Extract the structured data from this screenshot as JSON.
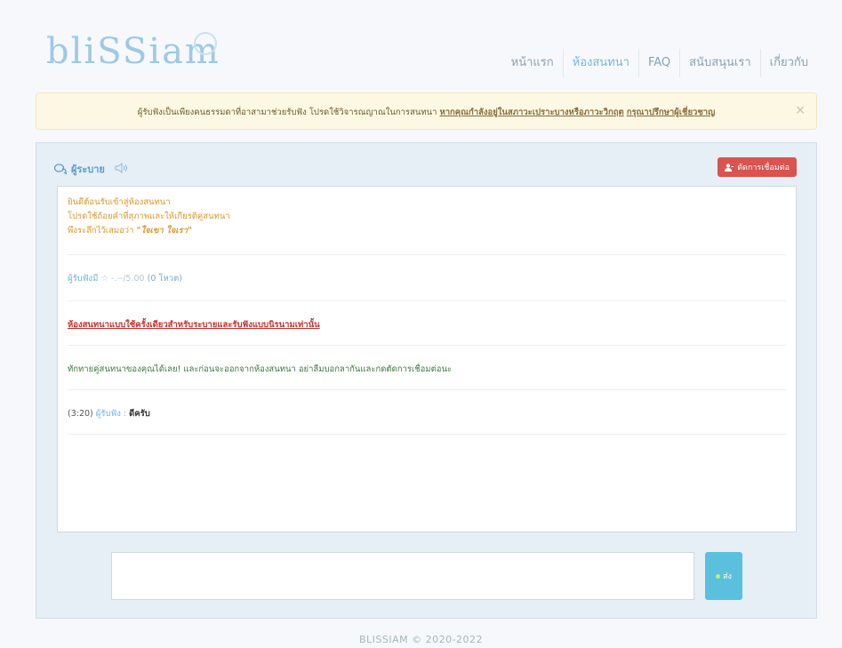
{
  "logo": {
    "text": "bliSSiam"
  },
  "nav": {
    "items": [
      {
        "label": "หน้าแรก",
        "active": false
      },
      {
        "label": "ห้องสนทนา",
        "active": true
      },
      {
        "label": "FAQ",
        "active": false
      },
      {
        "label": "สนับสนุนเรา",
        "active": false
      },
      {
        "label": "เกี่ยวกับ",
        "active": false
      }
    ]
  },
  "alert": {
    "text": "ผู้รับฟังเป็นเพียงคนธรรมดาที่อาสามาช่วยรับฟัง โปรดใช้วิจารณญาณในการสนทนา",
    "link1": "หากคุณกำลังอยู่ในสภาวะเปราะบางหรือภาวะวิกฤต",
    "link2": "กรุณาปรึกษาผู้เชี่ยวชาญ",
    "close": "×"
  },
  "chat": {
    "title": "ผู้ระบาย",
    "speaker_icon": "speaker-icon",
    "disconnect_label": "ตัดการเชื่อมต่อ",
    "welcome": {
      "line1": "ยินดีต้อนรับเข้าสู่ห้องสนทนา",
      "line2": "โปรดใช้ถ้อยคำที่สุภาพและให้เกียรติคู่สนทนา",
      "line3_prefix": "พึงระลึกไว้เสมอว่า",
      "line3_quote": "\"ใจเขา ใจเรา\""
    },
    "rating": {
      "label": "ผู้รับฟังมี",
      "star": "☆",
      "score": "-.--/5.00",
      "votes": "(0 โหวต)"
    },
    "notice": "ห้องสนทนาแบบใช้ครั้งเดียวสำหรับระบายและรับฟังแบบนิรนามเท่านั้น",
    "greeting": "ทักทายคู่สนทนาของคุณได้เลย! และก่อนจะออกจากห้องสนทนา อย่าลืมบอกลากันและกดตัดการเชื่อมต่อนะ",
    "messages": [
      {
        "time": "(3:20)",
        "sender": "ผู้รับฟัง",
        "separator": ":",
        "text": "ดีครับ"
      }
    ],
    "send_label": "ส่ง",
    "input_value": ""
  },
  "footer": {
    "text": "BLISSIAM © 2020-2022"
  },
  "colors": {
    "accent": "#79b3da",
    "danger": "#d9534f",
    "send": "#5bc0de",
    "welcome": "#e0962c"
  }
}
